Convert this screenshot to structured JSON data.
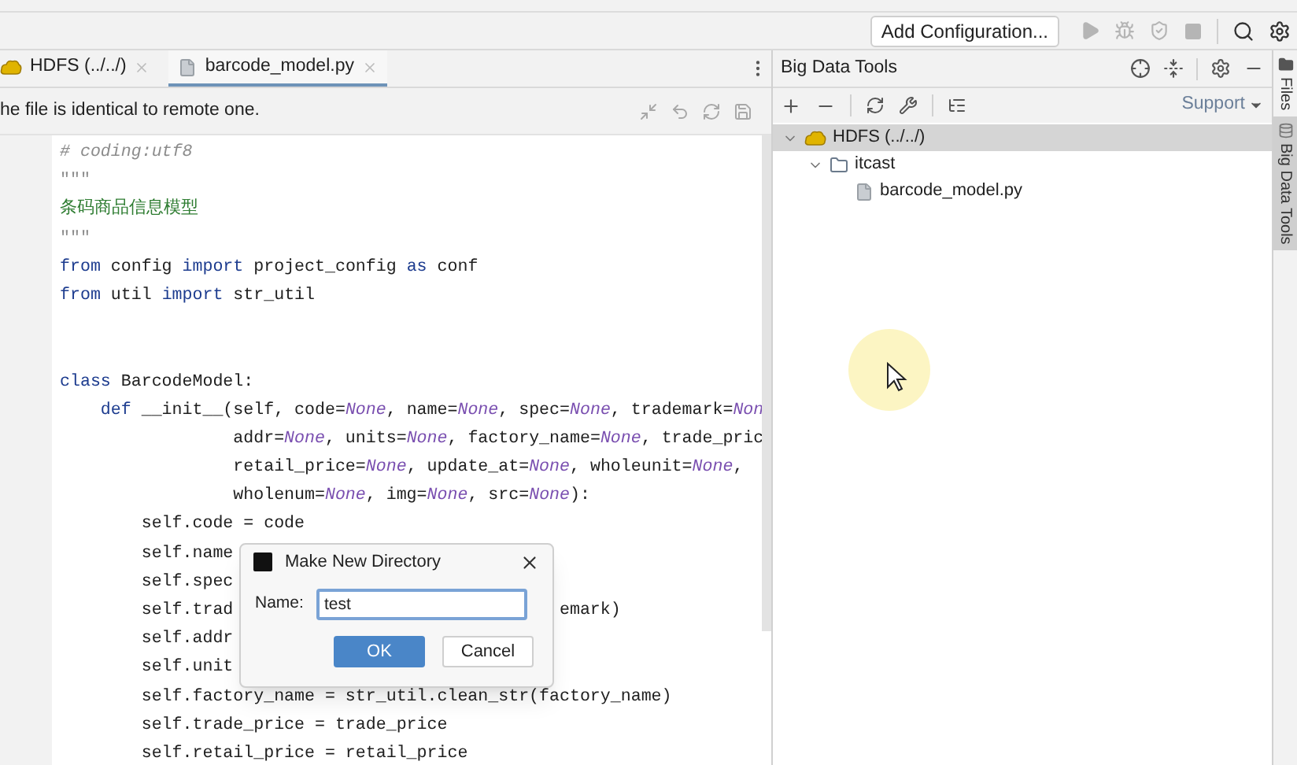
{
  "toolbar": {
    "run_configuration": "Add Configuration..."
  },
  "editor": {
    "tabs": [
      {
        "label": "HDFS (../../)",
        "kind": "hdfs",
        "selected": false
      },
      {
        "label": "barcode_model.py",
        "kind": "file",
        "selected": true
      }
    ],
    "banner": "he file is identical to remote one.",
    "code_lines": [
      {
        "tokens": [
          {
            "kind": "comment",
            "text": "# coding:utf8"
          }
        ]
      },
      {
        "tokens": [
          {
            "kind": "quote",
            "text": "\"\"\""
          }
        ]
      },
      {
        "tokens": [
          {
            "kind": "doc",
            "text": "条码商品信息模型"
          }
        ]
      },
      {
        "tokens": [
          {
            "kind": "quote",
            "text": "\"\"\""
          }
        ]
      },
      {
        "tokens": [
          {
            "kind": "kw",
            "text": "from"
          },
          {
            "kind": "plain",
            "text": " config "
          },
          {
            "kind": "kw",
            "text": "import"
          },
          {
            "kind": "plain",
            "text": " project_config "
          },
          {
            "kind": "kw",
            "text": "as"
          },
          {
            "kind": "plain",
            "text": " conf"
          }
        ]
      },
      {
        "tokens": [
          {
            "kind": "kw",
            "text": "from"
          },
          {
            "kind": "plain",
            "text": " util "
          },
          {
            "kind": "kw",
            "text": "import"
          },
          {
            "kind": "plain",
            "text": " str_util"
          }
        ]
      },
      {
        "blank_before": true,
        "tokens": [
          {
            "kind": "kw",
            "text": "class"
          },
          {
            "kind": "plain",
            "text": " BarcodeModel:"
          }
        ]
      },
      {
        "tokens": [
          {
            "kind": "kw",
            "text": "    def"
          },
          {
            "kind": "plain",
            "text": " __init__(self, code="
          },
          {
            "kind": "none",
            "text": "None"
          },
          {
            "kind": "plain",
            "text": ", name="
          },
          {
            "kind": "none",
            "text": "None"
          },
          {
            "kind": "plain",
            "text": ", spec="
          },
          {
            "kind": "none",
            "text": "None"
          },
          {
            "kind": "plain",
            "text": ", trademark="
          },
          {
            "kind": "none",
            "text": "Non"
          }
        ]
      },
      {
        "tokens": [
          {
            "kind": "plain",
            "text": "                 addr="
          },
          {
            "kind": "none",
            "text": "None"
          },
          {
            "kind": "plain",
            "text": ", units="
          },
          {
            "kind": "none",
            "text": "None"
          },
          {
            "kind": "plain",
            "text": ", factory_name="
          },
          {
            "kind": "none",
            "text": "None"
          },
          {
            "kind": "plain",
            "text": ", trade_pric"
          }
        ]
      },
      {
        "tokens": [
          {
            "kind": "plain",
            "text": "                 retail_price="
          },
          {
            "kind": "none",
            "text": "None"
          },
          {
            "kind": "plain",
            "text": ", update_at="
          },
          {
            "kind": "none",
            "text": "None"
          },
          {
            "kind": "plain",
            "text": ", wholeunit="
          },
          {
            "kind": "none",
            "text": "None"
          },
          {
            "kind": "plain",
            "text": ","
          }
        ]
      },
      {
        "tokens": [
          {
            "kind": "plain",
            "text": "                 wholenum="
          },
          {
            "kind": "none",
            "text": "None"
          },
          {
            "kind": "plain",
            "text": ", img="
          },
          {
            "kind": "none",
            "text": "None"
          },
          {
            "kind": "plain",
            "text": ", src="
          },
          {
            "kind": "none",
            "text": "None"
          },
          {
            "kind": "plain",
            "text": "):"
          }
        ]
      },
      {
        "tokens": [
          {
            "kind": "plain",
            "text": "        self.code = code"
          }
        ]
      },
      {
        "tokens": [
          {
            "kind": "plain",
            "text": "        self.name"
          }
        ]
      },
      {
        "tokens": [
          {
            "kind": "plain",
            "text": "        self.spec"
          }
        ]
      },
      {
        "tokens": [
          {
            "kind": "plain",
            "text": "        self.trad"
          }
        ],
        "tail": "emark)"
      },
      {
        "tokens": [
          {
            "kind": "plain",
            "text": "        self.addr"
          }
        ]
      },
      {
        "tokens": [
          {
            "kind": "plain",
            "text": "        self.unit"
          }
        ]
      },
      {
        "tokens": [
          {
            "kind": "plain",
            "text": "        self.factory_name = str_util.clean_str(factory_name)"
          }
        ]
      },
      {
        "tokens": [
          {
            "kind": "plain",
            "text": "        self.trade_price = trade_price"
          }
        ]
      },
      {
        "tokens": [
          {
            "kind": "plain",
            "text": "        self.retail_price = retail_price"
          }
        ]
      }
    ]
  },
  "dialog": {
    "title": "Make New Directory",
    "field_label": "Name:",
    "value": "test",
    "ok": "OK",
    "cancel": "Cancel"
  },
  "big_data_tools": {
    "title": "Big Data Tools",
    "support": "Support",
    "tree": [
      {
        "label": "HDFS (../../)",
        "kind": "hdfs",
        "expanded": true,
        "selected": true,
        "children": [
          {
            "label": "itcast",
            "kind": "folder",
            "expanded": true,
            "selected": false,
            "children": [
              {
                "label": "barcode_model.py",
                "kind": "file",
                "selected": false
              }
            ]
          }
        ]
      }
    ]
  },
  "side_stripe": [
    {
      "label": "Files",
      "kind": "files",
      "selected": false
    },
    {
      "label": "Big Data Tools",
      "kind": "bdt",
      "selected": true
    }
  ]
}
